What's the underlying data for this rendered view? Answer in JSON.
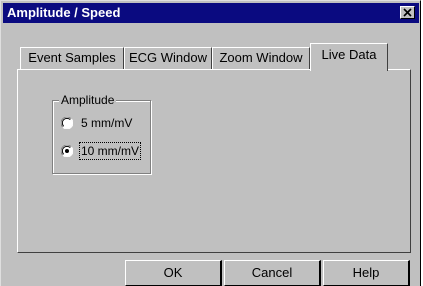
{
  "window": {
    "title": "Amplitude / Speed",
    "close_icon": "close-icon"
  },
  "tabs": [
    {
      "label": "Event Samples",
      "active": false
    },
    {
      "label": "ECG Window",
      "active": false
    },
    {
      "label": "Zoom Window",
      "active": false
    },
    {
      "label": "Live Data",
      "active": true
    }
  ],
  "amplitude_group": {
    "legend": "Amplitude",
    "options": [
      {
        "label": "5 mm/mV",
        "selected": false
      },
      {
        "label": "10 mm/mV",
        "selected": true
      }
    ]
  },
  "buttons": {
    "ok": "OK",
    "cancel": "Cancel",
    "help": "Help"
  },
  "colors": {
    "title_bar": "#0a0a80",
    "face": "#c0c0c0"
  }
}
